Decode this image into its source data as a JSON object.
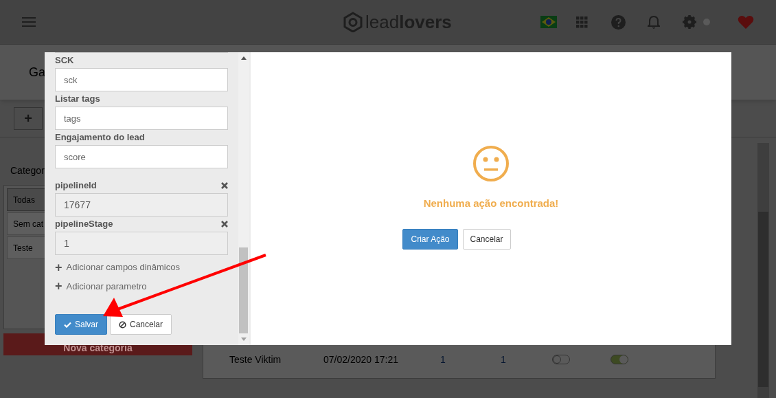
{
  "header": {
    "logo": "lead**lovers**"
  },
  "page": {
    "title": "Ga",
    "add_button": "+",
    "categories": {
      "heading": "Categor",
      "items": [
        {
          "label": "Todas",
          "selected": true
        },
        {
          "label": "Sem cat",
          "selected": false
        },
        {
          "label": "Teste",
          "selected": false
        }
      ],
      "new_button": "Nova categoria"
    },
    "table": {
      "rows": [
        {
          "cells": [
            "Teste Viktim",
            "07/02/2020 17:21",
            "1",
            "1"
          ],
          "toggles": [
            false,
            true
          ]
        }
      ]
    }
  },
  "modal": {
    "fields": [
      {
        "kind": "text",
        "label": "SCK",
        "placeholder": "sck"
      },
      {
        "kind": "text",
        "label": "Listar tags",
        "placeholder": "tags"
      },
      {
        "kind": "text",
        "label": "Engajamento do lead",
        "placeholder": "score"
      },
      {
        "kind": "removable",
        "label": "pipelineId",
        "value": "17677"
      },
      {
        "kind": "removable",
        "label": "pipelineStage",
        "value": "1"
      }
    ],
    "links": [
      {
        "icon": "+",
        "label": "Adicionar campos dinâmicos"
      },
      {
        "icon": "+",
        "label": "Adicionar parametro"
      }
    ],
    "save": "Salvar",
    "cancel": "Cancelar",
    "empty": {
      "message": "Nenhuma ação encontrada!",
      "create": "Criar Ação",
      "cancel": "Cancelar"
    }
  }
}
